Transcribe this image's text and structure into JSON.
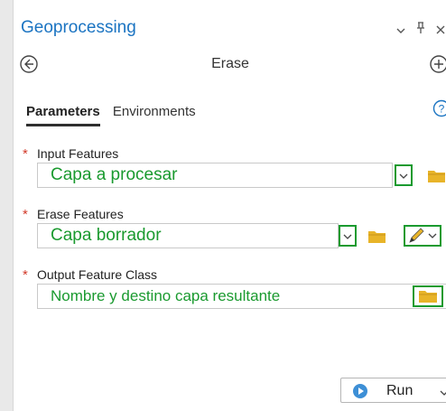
{
  "pane": {
    "title": "Geoprocessing",
    "tool_name": "Erase",
    "pin_glyph": "Ȩ​",
    "tabs": [
      {
        "label": "Parameters",
        "active": true
      },
      {
        "label": "Environments",
        "active": false
      }
    ]
  },
  "params": {
    "input": {
      "required_mark": "*",
      "label": "Input Features",
      "value": "Capa a procesar"
    },
    "erase": {
      "required_mark": "*",
      "label": "Erase Features",
      "value": "Capa borrador"
    },
    "output": {
      "required_mark": "*",
      "label": "Output Feature Class",
      "value": "Nombre y destino capa resultante"
    }
  },
  "run": {
    "label": "Run"
  },
  "colors": {
    "accent": "#1b74c2",
    "highlight": "#1a9a2f",
    "required": "#d23a2a",
    "folder": "#e8b429"
  },
  "icons": [
    "back-arrow-icon",
    "add-icon",
    "help-icon",
    "chevron-down-icon",
    "pin-icon",
    "close-icon",
    "folder-icon",
    "pencil-icon",
    "play-icon"
  ]
}
